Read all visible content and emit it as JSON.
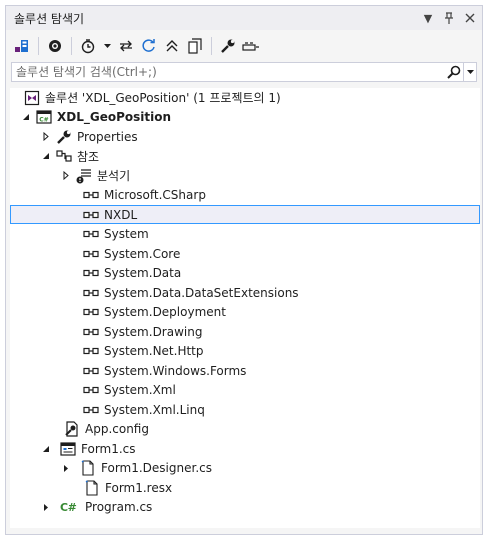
{
  "panel": {
    "title": "솔루션 탐색기",
    "search_placeholder": "솔루션 탐색기 검색(Ctrl+;)"
  },
  "tree": {
    "solution": "솔루션 'XDL_GeoPosition' (1 프로젝트의 1)",
    "project": "XDL_GeoPosition",
    "properties": "Properties",
    "references": "참조",
    "analyzers": "분석기",
    "refs": [
      "Microsoft.CSharp",
      "NXDL",
      "System",
      "System.Core",
      "System.Data",
      "System.Data.DataSetExtensions",
      "System.Deployment",
      "System.Drawing",
      "System.Net.Http",
      "System.Windows.Forms",
      "System.Xml",
      "System.Xml.Linq"
    ],
    "app_config": "App.config",
    "form1": "Form1.cs",
    "form1_designer": "Form1.Designer.cs",
    "form1_resx": "Form1.resx",
    "program": "Program.cs",
    "cs_badge": "C#",
    "selected": "NXDL"
  },
  "colors": {
    "accent": "#3399ff",
    "csharp": "#388a34",
    "blue_icon": "#1e6fd0",
    "purple": "#68217a"
  }
}
